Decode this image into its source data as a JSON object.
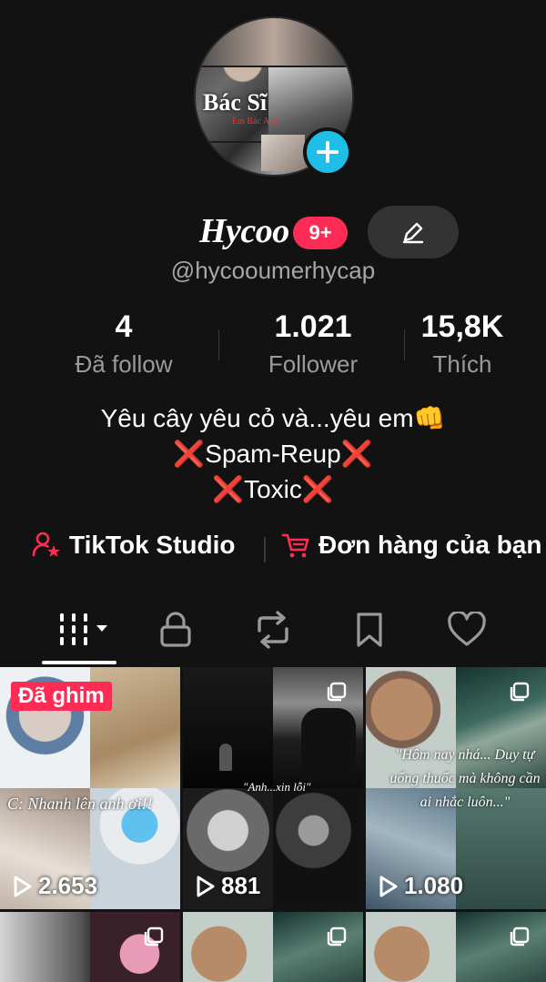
{
  "profile": {
    "avatar_text": "Bác Sĩ",
    "avatar_subtext": "Em  Bác Anh",
    "name": "Hycoo",
    "notification_badge": "9+",
    "handle": "@hycooumerhycap",
    "stats": [
      {
        "value": "4",
        "label": "Đã follow"
      },
      {
        "value": "1.021",
        "label": "Follower"
      },
      {
        "value": "15,8K",
        "label": "Thích"
      }
    ],
    "bio": {
      "line1": "Yêu cây yêu cỏ và...yêu em👊",
      "line2": "Spam-Reup",
      "line3": "Toxic",
      "mark": "❌"
    }
  },
  "links": {
    "studio": "TikTok Studio",
    "orders": "Đơn hàng của bạn"
  },
  "tabs": [
    "videos",
    "private",
    "reposts",
    "saved",
    "liked"
  ],
  "videos": [
    {
      "pinned_label": "Đã ghim",
      "caption": "C: Nhanh lên anh ơi!!",
      "views": "2.653"
    },
    {
      "caption": "\"Anh...xin lỗi\"",
      "views": "881"
    },
    {
      "caption": "\"Hôm nay nhá... Duy tự uống thuốc mà không cần ai nhắc luôn...\"",
      "views": "1.080"
    }
  ],
  "colors": {
    "accent": "#fe2c55",
    "plus": "#20bde6",
    "background": "#121212"
  }
}
